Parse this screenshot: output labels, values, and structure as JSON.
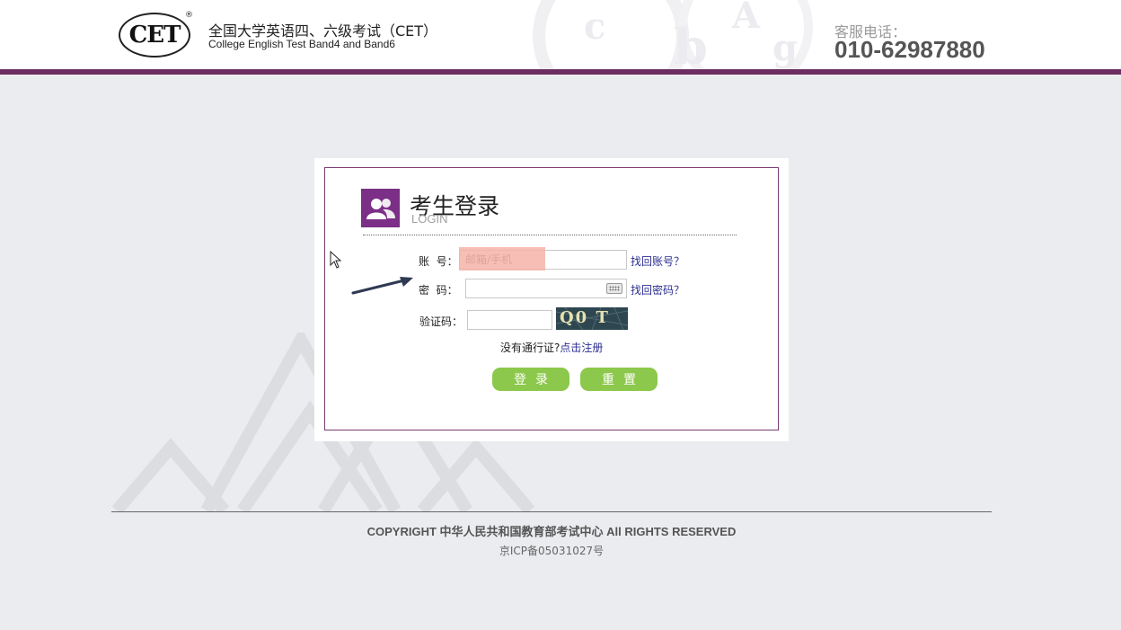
{
  "header": {
    "logo_text": "CET",
    "logo_reg": "®",
    "title_cn": "全国大学英语四、六级考试（CET）",
    "title_en": "College English Test Band4 and Band6",
    "hotline_label": "客服电话：",
    "hotline_number": "010-62987880",
    "accent_color": "#6b2d62"
  },
  "login": {
    "title": "考生登录",
    "subtitle": "LOGIN",
    "account_label": "账  号：",
    "account_placeholder": "邮箱/手机",
    "forgot_account": "找回账号？",
    "password_label": "密  码：",
    "forgot_password": "找回密码？",
    "captcha_label": "验证码：",
    "captcha_text": "Q0 T V",
    "no_pass_text": "没有通行证?",
    "register_link": "点击注册",
    "login_button": "登录",
    "reset_button": "重置",
    "button_color": "#8cc84b",
    "icon": "users-icon"
  },
  "footer": {
    "copyright": "COPYRIGHT 中华人民共和国教育部考试中心 All RIGHTS RESERVED",
    "icp": "京ICP备05031027号"
  }
}
